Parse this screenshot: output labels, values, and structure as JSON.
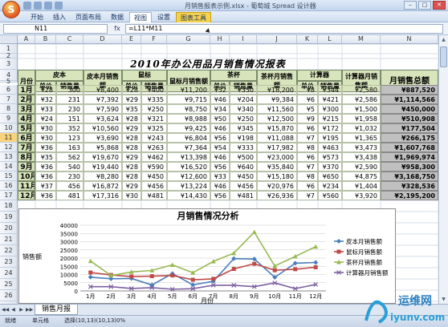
{
  "window": {
    "title": "月销售报表示例.xlsx - 葡萄城 Spread 设计器",
    "app_logo": "S",
    "controls": [
      "minimize",
      "maximize",
      "close"
    ]
  },
  "ribbon": {
    "tabs": [
      "开始",
      "插入",
      "页面布局",
      "数据",
      "视图",
      "设置",
      "图表工具"
    ],
    "selected": "视图",
    "contextual": "图表工具"
  },
  "formula_bar": {
    "name_box": "N11",
    "fx_label": "fx",
    "formula": "=L11*M11"
  },
  "columns": [
    "A",
    "B",
    "C",
    "D",
    "E",
    "F",
    "G",
    "H",
    "I",
    "J",
    "K",
    "L",
    "M",
    "N"
  ],
  "rows": [
    "1",
    "2",
    "3",
    "4",
    "5",
    "6",
    "7",
    "8",
    "9",
    "10",
    "11",
    "12",
    "13",
    "14",
    "15",
    "16",
    "17",
    "18",
    "19",
    "20",
    "21",
    "22",
    "23",
    "24",
    "25",
    "26",
    "27"
  ],
  "selected_row": "11",
  "sheet": {
    "title": "2010年办公用品月销售情况报表",
    "headers": {
      "month": "月份",
      "pencil": "皮本",
      "pencil_price": "单价",
      "pencil_qty": "销售量",
      "pencil_total": "皮本月销售额",
      "mouse": "鼠标",
      "mouse_price": "单价",
      "mouse_qty": "销售量",
      "mouse_total": "鼠标月销售额",
      "tea": "茶杯",
      "tea_price": "单价",
      "tea_qty": "销售量",
      "tea_total": "茶杯月销售额",
      "calc": "计算器",
      "calc_price": "单价",
      "calc_qty": "销售量",
      "calc_total": "计算器月销售额",
      "grand_total": "月销售总额"
    },
    "data_rows": [
      [
        "1月",
        "¥28",
        "300",
        "¥8,400",
        "¥28",
        "¥400",
        "¥11,200",
        "¥52",
        "¥350",
        "¥18,200",
        "¥8",
        "¥344",
        "¥2,580",
        "¥887,520"
      ],
      [
        "2月",
        "¥32",
        "231",
        "¥7,392",
        "¥29",
        "¥335",
        "¥9,715",
        "¥46",
        "¥204",
        "¥9,384",
        "¥6",
        "¥421",
        "¥2,586",
        "¥1,114,566"
      ],
      [
        "3月",
        "¥33",
        "230",
        "¥7,590",
        "¥35",
        "¥250",
        "¥8,750",
        "¥34",
        "¥340",
        "¥11,560",
        "¥5",
        "¥300",
        "¥1,500",
        "¥450,000"
      ],
      [
        "4月",
        "¥24",
        "151",
        "¥3,624",
        "¥28",
        "¥321",
        "¥8,988",
        "¥50",
        "¥250",
        "¥12,500",
        "¥9",
        "¥215",
        "¥1,958",
        "¥510,908"
      ],
      [
        "5月",
        "¥30",
        "352",
        "¥10,560",
        "¥29",
        "¥325",
        "¥9,425",
        "¥46",
        "¥345",
        "¥15,870",
        "¥6",
        "¥172",
        "¥1,032",
        "¥177,504"
      ],
      [
        "6月",
        "¥30",
        "123",
        "¥3,690",
        "¥28",
        "¥243",
        "¥6,804",
        "¥56",
        "¥198",
        "¥11,088",
        "¥7",
        "¥195",
        "¥1,365",
        "¥266,175"
      ],
      [
        "7月",
        "¥36",
        "163",
        "¥5,868",
        "¥28",
        "¥263",
        "¥7,364",
        "¥54",
        "¥333",
        "¥17,982",
        "¥8",
        "¥463",
        "¥3,473",
        "¥1,607,768"
      ],
      [
        "8月",
        "¥35",
        "562",
        "¥19,670",
        "¥29",
        "¥462",
        "¥13,398",
        "¥46",
        "¥500",
        "¥23,000",
        "¥6",
        "¥573",
        "¥3,438",
        "¥1,969,974"
      ],
      [
        "9月",
        "¥36",
        "540",
        "¥19,440",
        "¥28",
        "¥590",
        "¥16,520",
        "¥56",
        "¥640",
        "¥35,840",
        "¥7",
        "¥370",
        "¥2,590",
        "¥958,300"
      ],
      [
        "10月",
        "¥36",
        "230",
        "¥8,280",
        "¥28",
        "¥450",
        "¥12,600",
        "¥33",
        "¥450",
        "¥15,180",
        "¥8",
        "¥650",
        "¥4,875",
        "¥3,168,750"
      ],
      [
        "11月",
        "¥37",
        "456",
        "¥16,872",
        "¥29",
        "¥456",
        "¥13,224",
        "¥46",
        "¥456",
        "¥20,976",
        "¥6",
        "¥234",
        "¥1,404",
        "¥328,536"
      ],
      [
        "12月",
        "¥36",
        "481",
        "¥17,316",
        "¥30",
        "¥481",
        "¥14,430",
        "¥56",
        "¥481",
        "¥26,936",
        "¥7",
        "¥560",
        "¥3,920",
        "¥2,195,200"
      ]
    ]
  },
  "chart_data": {
    "type": "line",
    "title": "月销售情况分析",
    "xlabel": "月份",
    "ylabel": "销售额",
    "categories": [
      "1月",
      "2月",
      "3月",
      "4月",
      "5月",
      "6月",
      "7月",
      "8月",
      "9月",
      "10月",
      "11月",
      "12月"
    ],
    "ylim": [
      0,
      40000
    ],
    "yticks": [
      "0",
      "5000",
      "10000",
      "15000",
      "20000",
      "25000",
      "30000",
      "35000",
      "40000"
    ],
    "grid": true,
    "legend_position": "right",
    "series": [
      {
        "name": "皮本月销售额",
        "color": "#4a7ebb",
        "marker": "diamond",
        "values": [
          8400,
          7392,
          7590,
          3624,
          10560,
          3690,
          5868,
          19670,
          19440,
          8280,
          16872,
          17316
        ]
      },
      {
        "name": "鼠标月销售额",
        "color": "#be4b48",
        "marker": "square",
        "values": [
          11200,
          9715,
          8750,
          8988,
          9425,
          6804,
          7364,
          13398,
          16520,
          12600,
          13224,
          14430
        ]
      },
      {
        "name": "茶杯月销售额",
        "color": "#98b954",
        "marker": "triangle",
        "values": [
          18200,
          9384,
          11560,
          12500,
          15870,
          11088,
          17982,
          23000,
          35840,
          15180,
          20976,
          26936
        ]
      },
      {
        "name": "计算器月销售额",
        "color": "#7d60a0",
        "marker": "x",
        "values": [
          2580,
          2586,
          1500,
          1958,
          1032,
          1365,
          3473,
          3438,
          2590,
          4875,
          1404,
          3920
        ]
      }
    ]
  },
  "sheet_tabs": {
    "active": "销售月报"
  },
  "status_bar": {
    "left": "就绪",
    "mode": "单元格",
    "info": "选择(10,13)(10,13)0%"
  },
  "watermark": {
    "brand": "运维网",
    "url": "iyunv.com"
  }
}
